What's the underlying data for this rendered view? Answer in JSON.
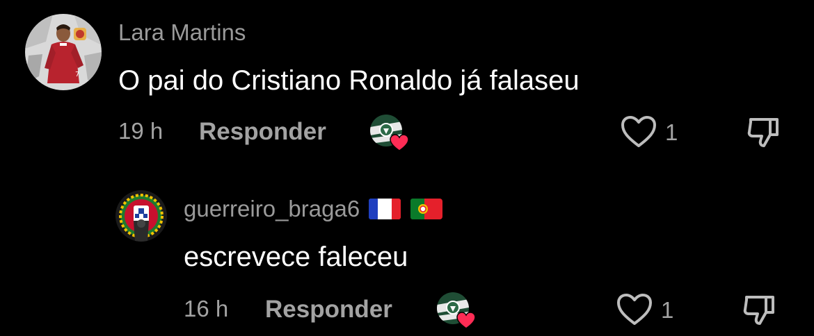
{
  "comments": [
    {
      "username": "Lara Martins",
      "text": "O pai do Cristiano Ronaldo já falaseu",
      "time": "19 h",
      "reply_label": "Responder",
      "likes": "1",
      "avatar_icon": "footballer-avatar",
      "creator_liked": true
    },
    {
      "username": "guerreiro_braga6",
      "username_flags": [
        "france-flag",
        "portugal-flag"
      ],
      "text": "escrevece faleceu",
      "time": "16 h",
      "reply_label": "Responder",
      "likes": "1",
      "avatar_icon": "portugal-coat-of-arms-avatar",
      "creator_liked": true
    }
  ],
  "colors": {
    "background": "#000000",
    "username": "#9a9a9a",
    "text": "#ffffff",
    "meta": "#a3a3a3",
    "heart_badge": "#fe2c55"
  }
}
